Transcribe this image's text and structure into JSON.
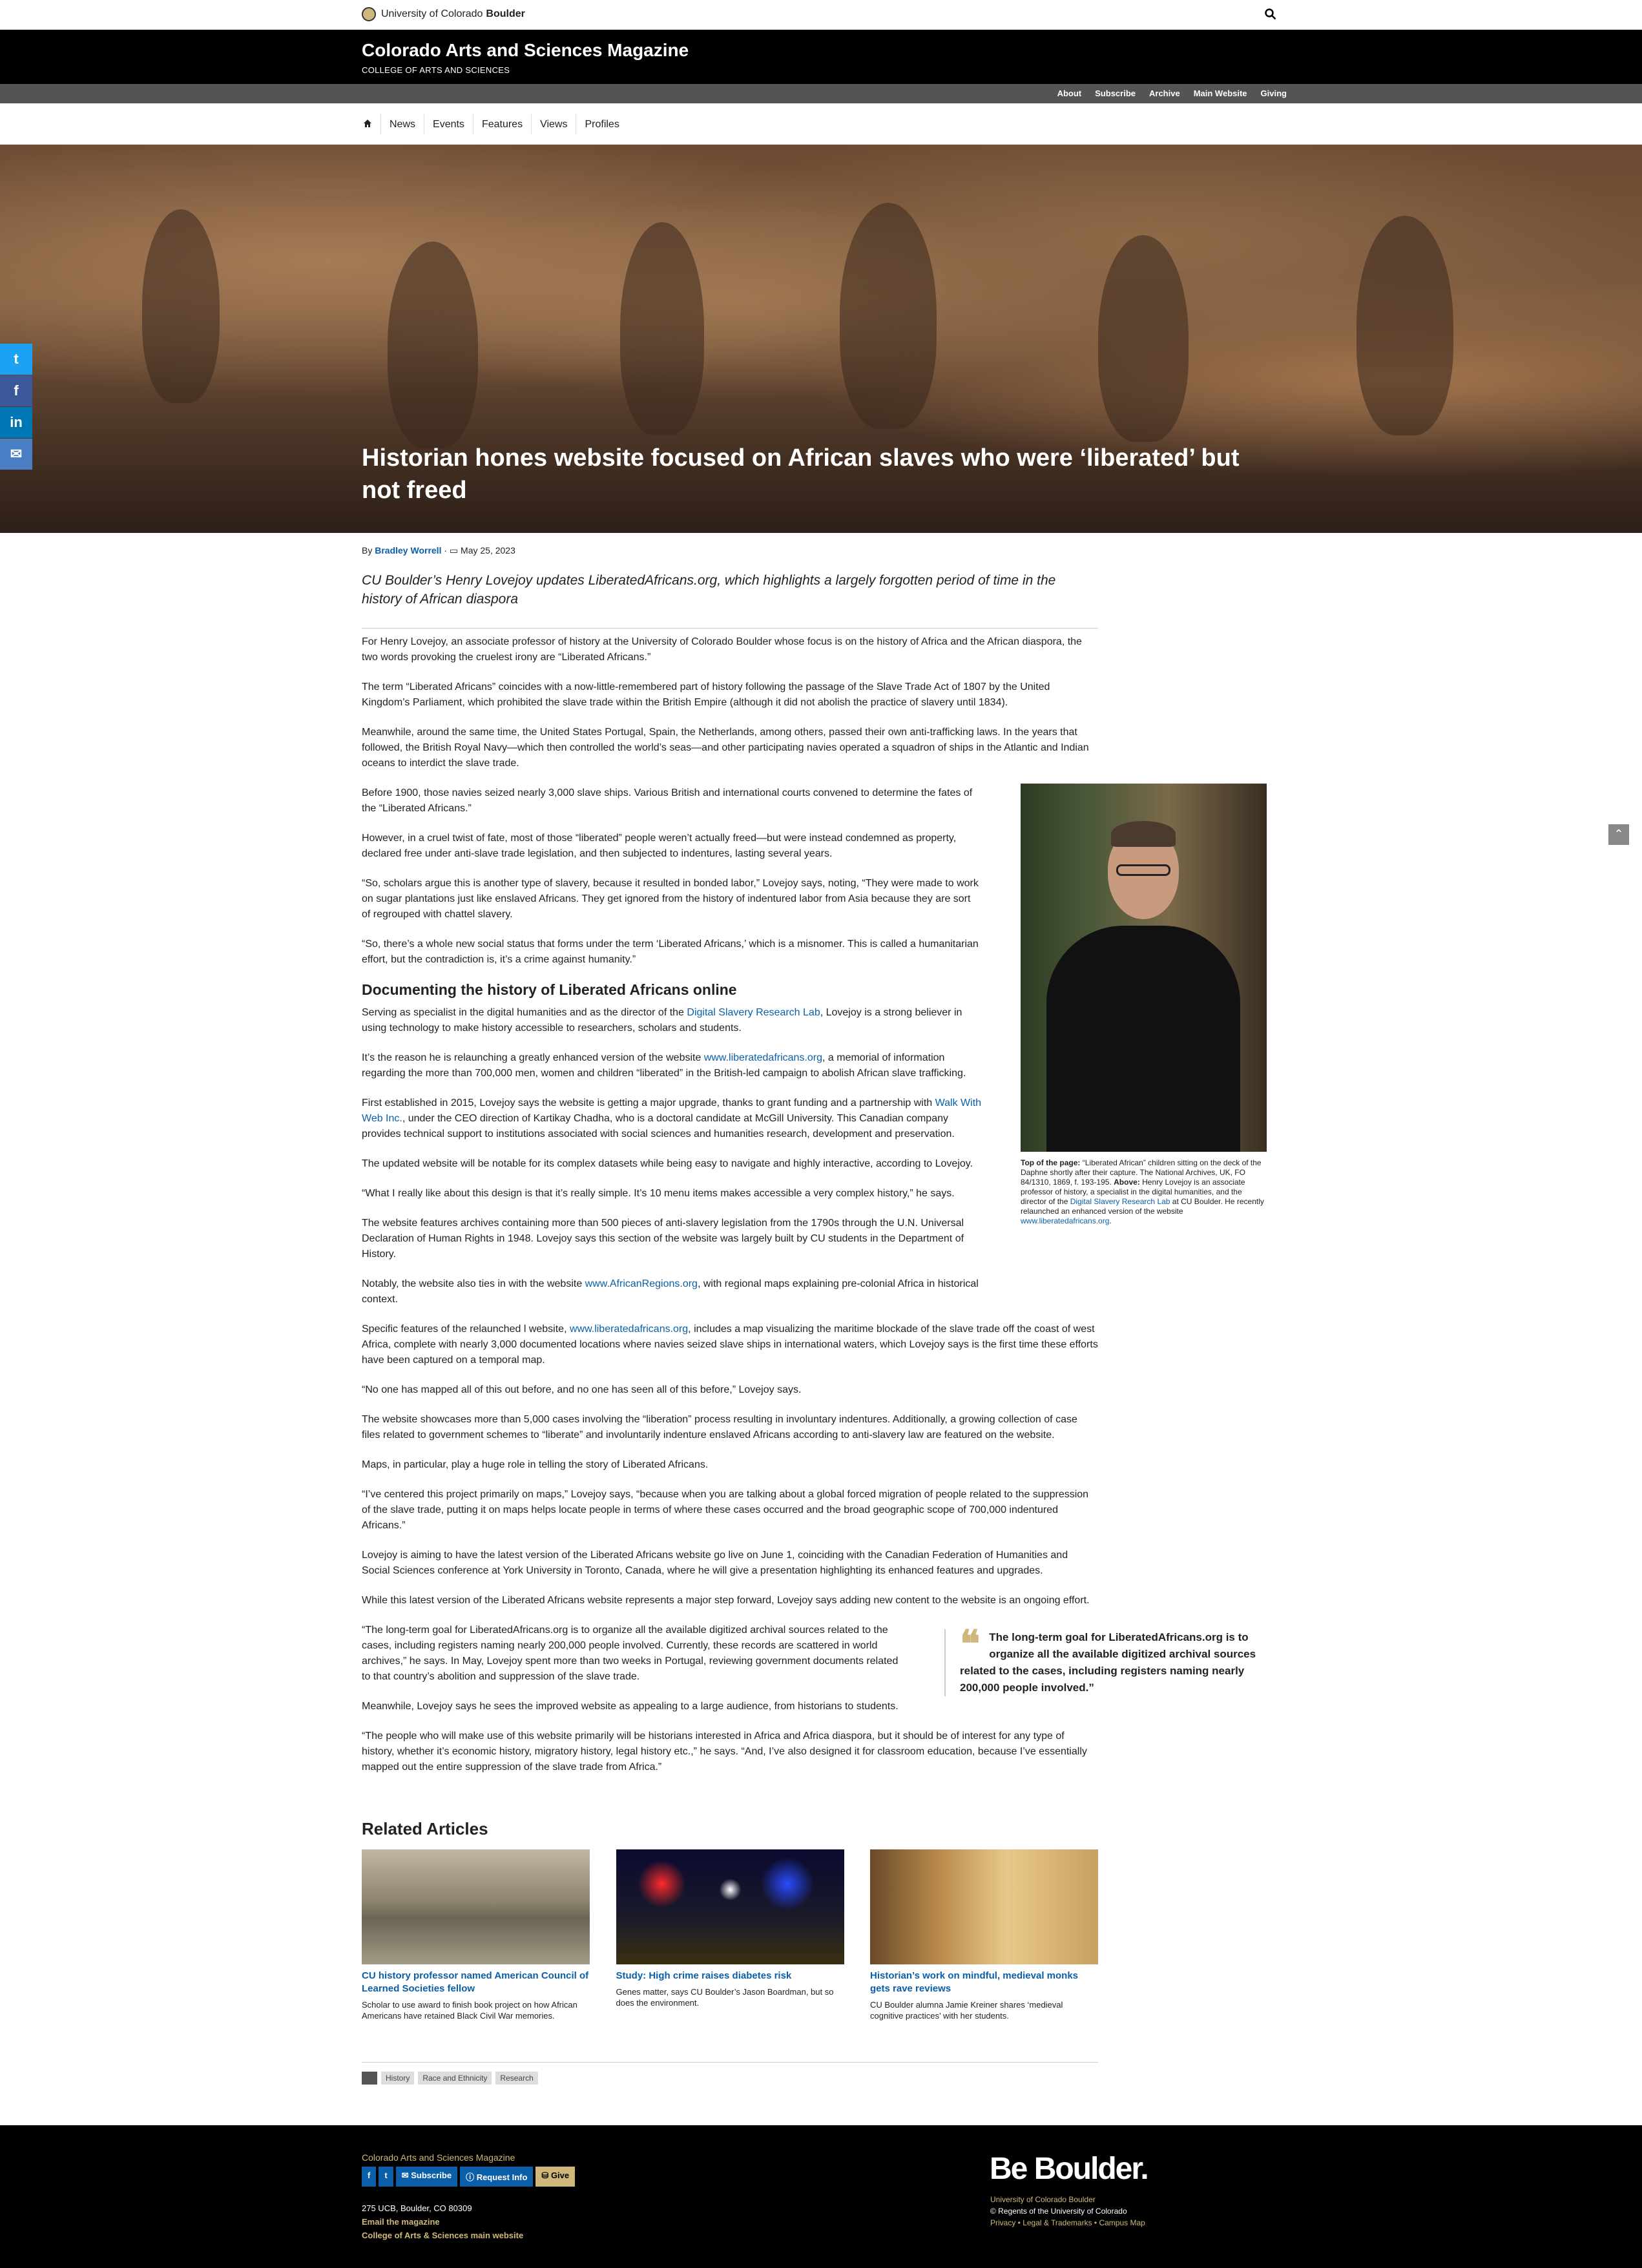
{
  "topbar": {
    "university": "University of Colorado",
    "campus": "Boulder"
  },
  "header": {
    "title": "Colorado Arts and Sciences Magazine",
    "subtitle": "COLLEGE OF ARTS AND SCIENCES"
  },
  "utility_nav": [
    "About",
    "Subscribe",
    "Archive",
    "Main Website",
    "Giving"
  ],
  "main_nav": [
    "News",
    "Events",
    "Features",
    "Views",
    "Profiles"
  ],
  "hero": {
    "title": "Historian hones website focused on African slaves who were ‘liberated’ but not freed"
  },
  "byline": {
    "prefix": "By",
    "author": "Bradley Worrell",
    "date": "May 25, 2023"
  },
  "summary": "CU Boulder’s Henry Lovejoy updates LiberatedAfricans.org, which highlights a largely forgotten period of time in the history of African diaspora",
  "article": {
    "p1": "For Henry Lovejoy, an associate professor of history at the University of Colorado Boulder whose focus is on the history of Africa and the African diaspora, the two words provoking the cruelest irony are “Liberated Africans.”",
    "p2": "The term “Liberated Africans” coincides with a now-little-remembered part of history following the passage of the Slave Trade Act of 1807 by the United Kingdom’s Parliament, which prohibited the slave trade within the British Empire (although it did not abolish the practice of slavery until 1834).",
    "p3": "Meanwhile, around the same time, the United States Portugal, Spain, the Netherlands, among others, passed their own anti-trafficking laws. In the years that followed, the British Royal Navy—which then controlled the world’s seas—and other participating navies operated a squadron of ships in the Atlantic and Indian oceans to interdict the slave trade.",
    "p4": "Before 1900, those navies seized nearly 3,000 slave ships. Various British and international courts convened to determine the fates of the “Liberated Africans.”",
    "p5": "However, in a cruel twist of fate, most of those “liberated” people weren’t actually freed—but were instead condemned as property, declared free under anti-slave trade legislation, and then subjected to indentures, lasting several years.",
    "p6": "“So, scholars argue this is another type of slavery, because it resulted in bonded labor,” Lovejoy says, noting, “They were made to work on sugar plantations just like enslaved Africans. They get ignored from the history of indentured labor from Asia because they are sort of regrouped with chattel slavery.",
    "p7": "“So, there’s a whole new social status that forms under the term ‘Liberated Africans,’ which is a misnomer. This is called a humanitarian effort, but the contradiction is, it’s a crime against humanity.”",
    "h2": "Documenting the history of Liberated Africans online",
    "p8a": "Serving as specialist in the digital humanities and as the director of the ",
    "p8link": "Digital Slavery Research Lab",
    "p8b": ", Lovejoy is a strong believer in using technology to make history accessible to researchers, scholars and students.",
    "p9a": "It’s the reason he is relaunching a greatly enhanced version of the website ",
    "p9link": "www.liberatedafricans.org",
    "p9b": ", a memorial of information regarding the more than 700,000 men, women and children “liberated” in the British-led campaign to abolish African slave trafficking.",
    "p10a": "First established in 2015, Lovejoy says the website is getting a major upgrade, thanks to grant funding and a partnership with ",
    "p10link": "Walk With Web Inc.",
    "p10b": ", under the CEO direction of Kartikay Chadha, who is a doctoral candidate at McGill University. This Canadian company provides technical support to institutions associated with social sciences and humanities research, development and preservation.",
    "p11": "The updated website will be notable for its complex datasets while being easy to navigate and highly interactive, according to Lovejoy.",
    "p12": "“What I really like about this design is that it’s really simple. It’s 10 menu items makes accessible a very complex history,” he says.",
    "p13": "The website features archives containing more than 500 pieces of anti-slavery legislation from the 1790s through the U.N. Universal Declaration of Human Rights in 1948. Lovejoy says this section of the website was largely built by CU students in the Department of History.",
    "p14a": "Notably, the website also ties in with the website ",
    "p14link": "www.AfricanRegions.org",
    "p14b": ", with regional maps explaining pre-colonial Africa in historical context.",
    "p15a": "Specific features of the relaunched l website, ",
    "p15link": "www.liberatedafricans.org",
    "p15b": ", includes a map visualizing the maritime blockade of the slave trade off the coast of west Africa, complete with nearly 3,000 documented locations where navies seized slave ships in international waters, which Lovejoy says is the first time these efforts have been captured on a temporal map.",
    "p16": "“No one has mapped all of this out before, and no one has seen all of this before,” Lovejoy says.",
    "p17": "The website showcases more than 5,000 cases involving the “liberation” process resulting in involuntary indentures. Additionally, a growing collection of case files related to government schemes to “liberate” and involuntarily indenture enslaved Africans according to anti-slavery law are featured on the website.",
    "p18": "Maps, in particular, play a huge role in telling the story of Liberated Africans.",
    "p19": "“I’ve centered this project primarily on maps,” Lovejoy says, “because when you are talking about a global forced migration of people related to the suppression of the slave trade, putting it on maps helps locate people in terms of where these cases occurred and the broad geographic scope of 700,000 indentured Africans.”",
    "p20": "Lovejoy is aiming to have the latest version of the Liberated Africans website go live on June 1, coinciding with the Canadian Federation of Humanities and Social Sciences conference at York University in Toronto, Canada, where he will give a presentation highlighting its enhanced features and upgrades.",
    "p21": "While this latest version of the Liberated Africans website represents a major step forward, Lovejoy says adding new content to the website is an ongoing effort.",
    "p22": "“The long-term goal for LiberatedAfricans.org is to organize all the available digitized archival sources related to the cases, including registers naming nearly 200,000 people involved. Currently, these records are scattered in world archives,” he says. In May, Lovejoy spent more than two weeks in Portugal, reviewing government documents related to that country’s abolition and suppression of the slave trade.",
    "p23": "Meanwhile, Lovejoy says he sees the improved website as appealing to a large audience, from historians to students.",
    "p24": "“The people who will make use of this website primarily will be historians interested in Africa and Africa diaspora, but it should be of interest for any type of history, whether it’s economic history, migratory history, legal history etc.,” he says. “And, I’ve also designed it for classroom education, because I’ve essentially mapped out the entire suppression of the slave trade from Africa.”"
  },
  "photo_caption": {
    "lead1": "Top of the page:",
    "text1": " “Liberated African” children sitting on the deck of the Daphne shortly after their capture. The National Archives, UK, FO 84/1310, 1869, f. 193-195. ",
    "lead2": "Above:",
    "text2": " Henry Lovejoy is an associate professor of history, a specialist in the digital humanities, and the director of the ",
    "link1": "Digital Slavery Research Lab",
    "text3": " at CU Boulder. He recently relaunched an enhanced version of the website ",
    "link2": "www.liberatedafricans.org",
    "text4": "."
  },
  "pullquote": "The long-term goal for LiberatedAfricans.org is to organize all the available digitized archival sources related to the cases, including registers naming nearly 200,000 people involved.”",
  "related": {
    "heading": "Related Articles",
    "items": [
      {
        "title": "CU history professor named American Council of Learned Societies fellow",
        "desc": "Scholar to use award to finish book project on how African Americans have retained Black Civil War memories."
      },
      {
        "title": "Study: High crime raises diabetes risk",
        "desc": "Genes matter, says CU Boulder’s Jason Boardman, but so does the environment."
      },
      {
        "title": "Historian’s work on mindful, medieval monks gets rave reviews",
        "desc": "CU Boulder alumna Jamie Kreiner shares ‘medieval cognitive practices’ with her students."
      }
    ]
  },
  "tags": [
    "History",
    "Race and Ethnicity",
    "Research"
  ],
  "footer": {
    "magazine": "Colorado Arts and Sciences Magazine",
    "buttons": {
      "fb": "f",
      "tw": "t",
      "subscribe": "Subscribe",
      "request": "Request Info",
      "give": "Give"
    },
    "address": "275 UCB, Boulder, CO 80309",
    "email": "Email the magazine",
    "main_site": "College of Arts & Sciences main website",
    "be_boulder": "Be Boulder.",
    "univ": "University of Colorado Boulder",
    "regents": "© Regents of the University of Colorado",
    "links": "Privacy • Legal & Trademarks • Campus Map"
  },
  "colors": {
    "gold": "#cfb87c",
    "link": "#0a5fa8",
    "black": "#000000"
  }
}
